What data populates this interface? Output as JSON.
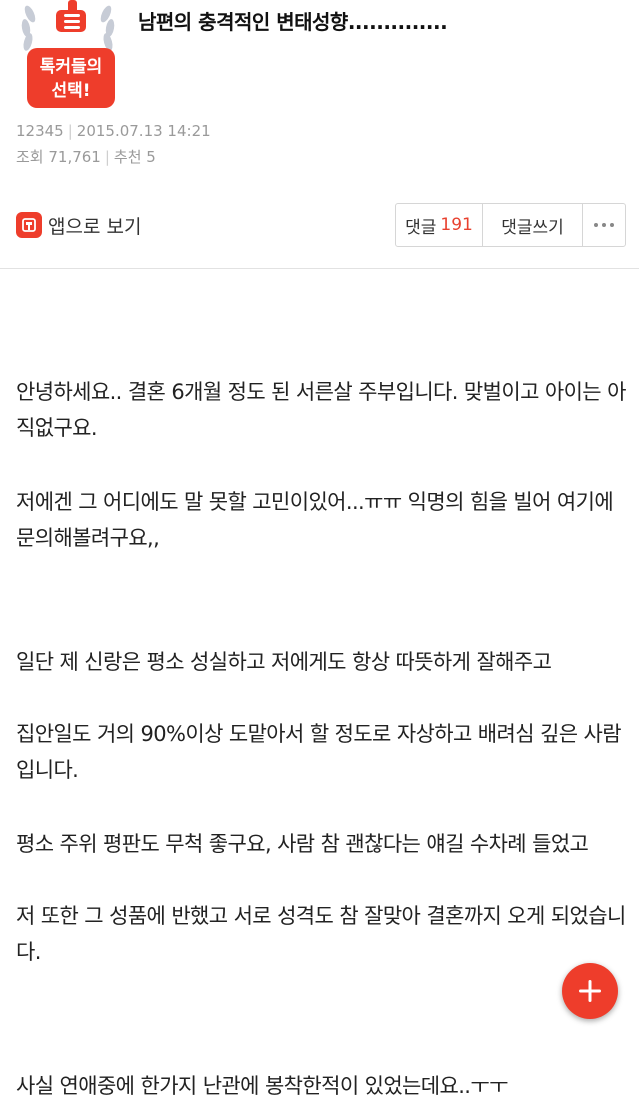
{
  "header": {
    "badge_line1": "톡커들의",
    "badge_line2": "선택!",
    "title": "남편의 충격적인 변태성향.............."
  },
  "meta": {
    "author_id": "12345",
    "date": "2015.07.13 14:21",
    "views": "조회 71,761",
    "recommends": "추천 5"
  },
  "actions": {
    "app_view_label": "앱으로 보기",
    "comments_label": "댓글",
    "comments_count": "191",
    "write_comment_label": "댓글쓰기"
  },
  "post": {
    "paragraphs": [
      "안녕하세요.. 결혼 6개월 정도 된 서른살 주부입니다. 맞벌이고 아이는 아직없구요.",
      "저에겐 그 어디에도 말 못할 고민이있어...ㅠㅠ 익명의 힘을 빌어 여기에 문의해볼려구요,,",
      "일단 제 신랑은 평소 성실하고 저에게도 항상 따뜻하게 잘해주고",
      "집안일도 거의 90%이상 도맡아서 할 정도로 자상하고 배려심 깊은 사람입니다.",
      "평소 주위 평판도 무척 좋구요, 사람 참 괜찮다는 얘길 수차례 들었고",
      "저 또한 그 성품에 반했고 서로 성격도 참 잘맞아 결혼까지 오게 되었습니다.",
      "사실 연애중에 한가지 난관에 봉착한적이 있었는데요..ㅜㅜ"
    ]
  },
  "colors": {
    "accent": "#ee3d2b",
    "count": "#e8412f"
  }
}
